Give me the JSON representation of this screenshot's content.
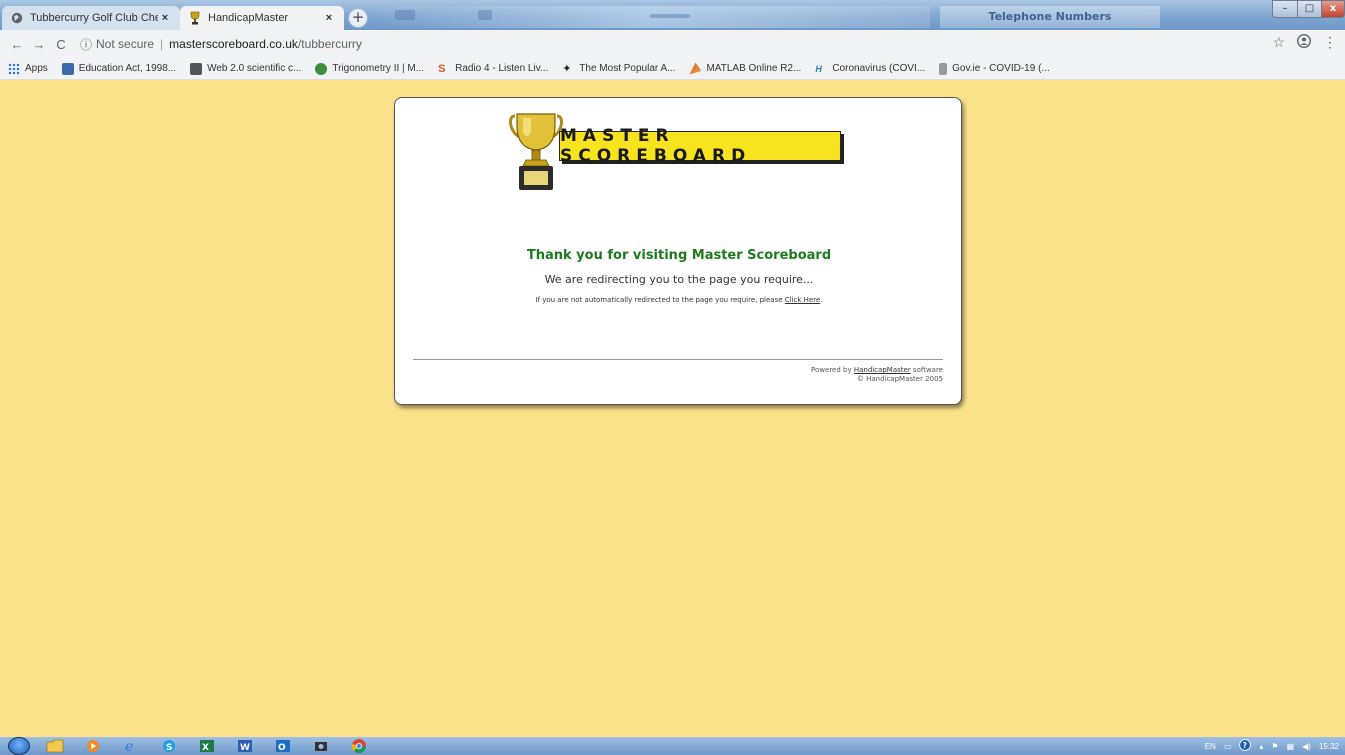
{
  "browser": {
    "tabs": [
      {
        "title": "Tubbercurry Golf Club Check Re:",
        "close": "×"
      },
      {
        "title": "HandicapMaster",
        "close": "×"
      }
    ],
    "new_tab": "+",
    "background_window_title": "Telephone Numbers",
    "address": {
      "security": "Not secure",
      "host": "masterscoreboard.co.uk",
      "path": "/tubbercurry"
    },
    "bookmarks": [
      {
        "label": "Apps",
        "icon": "apps-grid-icon",
        "color": "#1a73e8"
      },
      {
        "label": "Education Act, 1998...",
        "icon": "bookmark-icon",
        "color": "#3b6aa8"
      },
      {
        "label": "Web 2.0 scientific c...",
        "icon": "calculator-icon",
        "color": "#444"
      },
      {
        "label": "Trigonometry II | M...",
        "icon": "bookmark-icon",
        "color": "#3a8f3a"
      },
      {
        "label": "Radio 4 - Listen Liv...",
        "icon": "radio-icon",
        "color": "#e0562a"
      },
      {
        "label": "The Most Popular A...",
        "icon": "pin-icon",
        "color": "#222"
      },
      {
        "label": "MATLAB Online R2...",
        "icon": "matlab-icon",
        "color": "#d4642a"
      },
      {
        "label": "Coronavirus (COVI...",
        "icon": "hse-icon",
        "color": "#2c7ec0"
      },
      {
        "label": "Gov.ie - COVID-19 (...",
        "icon": "gov-icon",
        "color": "#7a7a7a"
      }
    ]
  },
  "page": {
    "logo_text": "MASTER SCOREBOARD",
    "heading": "Thank you for visiting Master Scoreboard",
    "subheading": "We are redirecting you to the page you require...",
    "notice_prefix": "If you are not automatically redirected to the page you require, please ",
    "notice_link": "Click Here",
    "notice_suffix": ".",
    "footer_prefix": "Powered by ",
    "footer_link": "HandicapMaster",
    "footer_suffix": " software",
    "copyright": "© HandicapMaster 2005",
    "colors": {
      "background": "#fbe28a",
      "heading": "#1f7a1f",
      "banner": "#f8e31f"
    }
  },
  "taskbar": {
    "language": "EN",
    "clock": "15:32"
  }
}
